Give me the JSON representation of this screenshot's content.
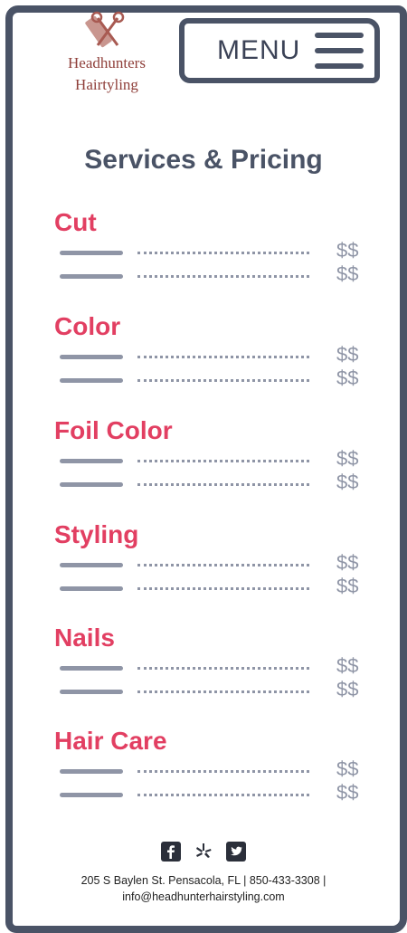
{
  "header": {
    "logo_line1": "Headhunters",
    "logo_line2": "Hairtyling",
    "menu_label": "MENU"
  },
  "page_title": "Services & Pricing",
  "sections": [
    {
      "title": "Cut",
      "prices": [
        "$$",
        "$$"
      ]
    },
    {
      "title": "Color",
      "prices": [
        "$$",
        "$$"
      ]
    },
    {
      "title": "Foil Color",
      "prices": [
        "$$",
        "$$"
      ]
    },
    {
      "title": "Styling",
      "prices": [
        "$$",
        "$$"
      ]
    },
    {
      "title": "Nails",
      "prices": [
        "$$",
        "$$"
      ]
    },
    {
      "title": "Hair Care",
      "prices": [
        "$$",
        "$$"
      ]
    }
  ],
  "footer": {
    "social_icons": [
      "facebook-icon",
      "yelp-icon",
      "twitter-icon"
    ],
    "address_line": "205 S Baylen St. Pensacola, FL | 850-433-3308 |",
    "email": "info@headhunterhairstyling.com"
  },
  "colors": {
    "frame": "#4a5366",
    "accent": "#e23f62",
    "muted": "#8f95a6",
    "logo": "#8f3f3a"
  }
}
